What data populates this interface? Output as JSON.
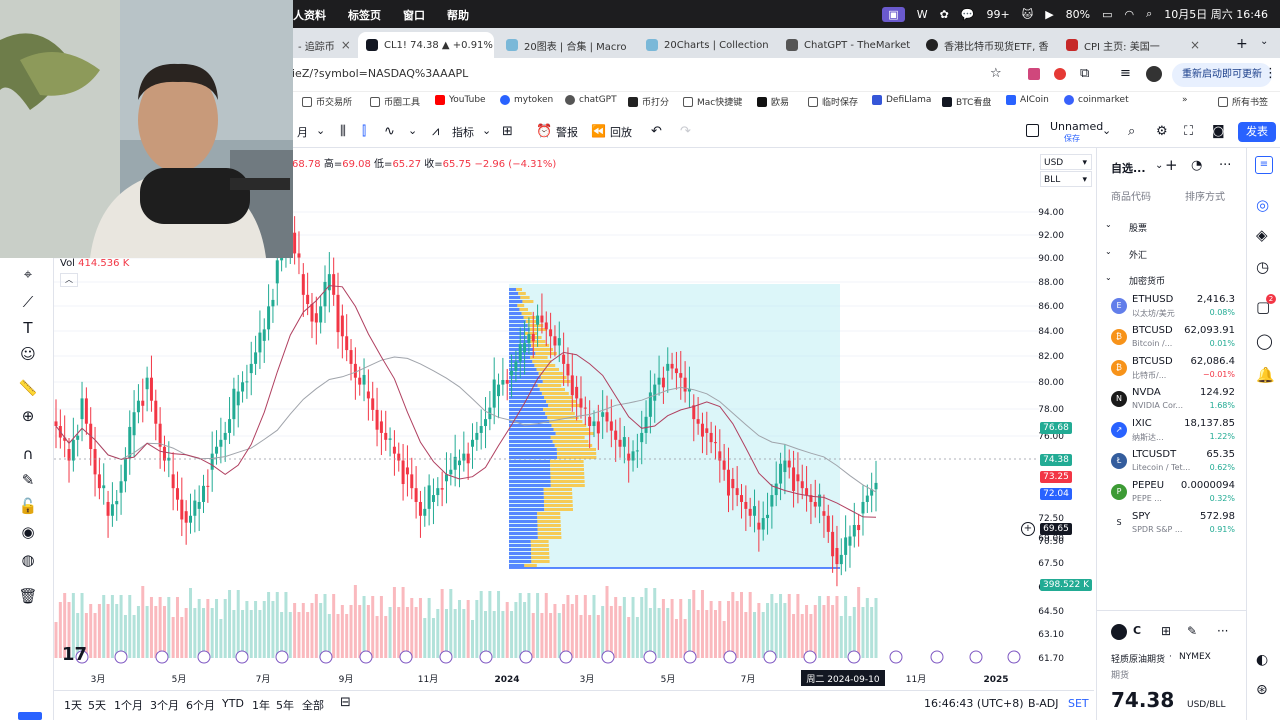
{
  "menubar": {
    "items": [
      "人资料",
      "标签页",
      "窗口",
      "帮助"
    ],
    "battery": "80%",
    "badge": "99+",
    "datetime": "10月5日 周六 16:46"
  },
  "tabs": [
    {
      "label": "- 追踪币",
      "active": false
    },
    {
      "label": "CL1! 74.38 ▲ +0.91%",
      "active": true
    },
    {
      "label": "20图表 | 合集 | Macro",
      "active": false
    },
    {
      "label": "20Charts | Collection",
      "active": false
    },
    {
      "label": "ChatGPT - TheMarket",
      "active": false
    },
    {
      "label": "香港比特币现货ETF, 香",
      "active": false
    },
    {
      "label": "CPI 主页: 美国一",
      "active": false
    }
  ],
  "address": {
    "url": "ieZ/?symbol=NASDAQ%3AAAPL",
    "restart_label": "重新启动即可更新"
  },
  "bookmarks": [
    "币交易所",
    "币圈工具",
    "YouTube",
    "mytoken",
    "chatGPT",
    "币打分",
    "Mac快捷键",
    "欧易",
    "临时保存",
    "DefiLlama",
    "BTC看盘",
    "AICoin",
    "coinmarket",
    "所有书签"
  ],
  "tv_toolbar": {
    "interval": "月",
    "indicators": "指标",
    "alert": "警报",
    "replay": "回放",
    "layout_name": "Unnamed",
    "layout_status": "保存",
    "publish": "发表"
  },
  "ohlc": {
    "prefix": "68.78",
    "high_label": "高=",
    "high": "69.08",
    "low_label": "低=",
    "low": "65.27",
    "close_label": "收=",
    "close": "65.75",
    "change": "−2.96 (−4.31%)"
  },
  "volume": {
    "label": "Vol",
    "value": "414.536 K"
  },
  "currency_select": "USD",
  "unit_select": "BLL",
  "price_labels": [
    {
      "value": "76.68",
      "color": "#22ab94"
    },
    {
      "value": "74.38",
      "color": "#22ab94"
    },
    {
      "value": "73.25",
      "color": "#f23645"
    },
    {
      "value": "72.04",
      "color": "#2962ff"
    },
    {
      "value": "69.65",
      "color": "#131722"
    },
    {
      "value": "398.522 K",
      "color": "#22ab94"
    }
  ],
  "chart_data": {
    "type": "candlestick",
    "y_ticks": [
      "94.00",
      "92.00",
      "90.00",
      "88.00",
      "86.00",
      "84.00",
      "82.00",
      "80.00",
      "78.00",
      "76.00",
      "72.50",
      "70.50",
      "69.00",
      "67.50",
      "66.00",
      "64.50",
      "63.10",
      "61.70"
    ],
    "x_ticks": [
      "3月",
      "5月",
      "7月",
      "9月",
      "11月",
      "2024",
      "3月",
      "5月",
      "7月",
      "周二 2024-09-10",
      "11月",
      "2025"
    ],
    "crosshair_date": "周二 2024-09-10",
    "crosshair_price": "69.65",
    "closes": [
      78.5,
      76.0,
      80.5,
      75.0,
      72.0,
      74.5,
      79.5,
      82.0,
      77.0,
      74.0,
      71.5,
      73.0,
      76.5,
      78.0,
      81.0,
      83.0,
      85.5,
      90.5,
      92.5,
      88.0,
      86.0,
      89.5,
      85.0,
      82.0,
      80.5,
      78.0,
      76.5,
      75.0,
      72.0,
      73.5,
      75.0,
      76.0,
      77.5,
      79.0,
      81.5,
      82.5,
      84.5,
      86.5,
      85.0,
      83.0,
      80.5,
      78.5,
      79.5,
      77.5,
      76.0,
      78.0,
      81.5,
      83.0,
      82.0,
      79.0,
      78.0,
      76.0,
      74.0,
      72.5,
      71.0,
      73.5,
      76.0,
      74.5,
      73.0,
      72.0,
      68.5,
      70.5,
      73.0,
      74.38
    ]
  },
  "bottom_bar": {
    "ranges": [
      "1天",
      "5天",
      "1个月",
      "3个月",
      "6个月",
      "YTD",
      "1年",
      "5年",
      "全部"
    ],
    "time": "16:46:43 (UTC+8)",
    "adj": "B-ADJ",
    "set": "SET"
  },
  "watchlist": {
    "title": "自选...",
    "col_symbol": "商品代码",
    "col_sort": "排序方式",
    "sections": [
      "股票",
      "外汇",
      "加密货币"
    ],
    "items": [
      {
        "symbol": "ETHUSD",
        "desc": "以太坊/美元",
        "last": "2,416.3",
        "chg": "0.08%",
        "up": true,
        "icon_color": "#627eea",
        "icon": "E"
      },
      {
        "symbol": "BTCUSD",
        "desc": "Bitcoin /...",
        "last": "62,093.91",
        "chg": "0.01%",
        "up": true,
        "icon_color": "#f7931a",
        "icon": "₿"
      },
      {
        "symbol": "BTCUSD",
        "desc": "比特币/...",
        "last": "62,086.4",
        "chg": "−0.01%",
        "up": false,
        "icon_color": "#f7931a",
        "icon": "₿"
      },
      {
        "symbol": "NVDA",
        "desc": "NVIDIA Cor...",
        "last": "124.92",
        "chg": "1.68%",
        "up": true,
        "icon_color": "#1a1a1a",
        "icon": "N"
      },
      {
        "symbol": "IXIC",
        "desc": "纳斯达...",
        "last": "18,137.85",
        "chg": "1.22%",
        "up": true,
        "icon_color": "#2962ff",
        "icon": "↗"
      },
      {
        "symbol": "LTCUSDT",
        "desc": "Litecoin / Tet...",
        "last": "65.35",
        "chg": "0.62%",
        "up": true,
        "icon_color": "#345d9d",
        "icon": "Ł"
      },
      {
        "symbol": "PEPEU",
        "desc": "PEPE ...",
        "last": "0.0000094",
        "chg": "0.32%",
        "up": true,
        "icon_color": "#3d9b35",
        "icon": "P"
      },
      {
        "symbol": "SPY",
        "desc": "SPDR S&P ...",
        "last": "572.98",
        "chg": "0.91%",
        "up": true,
        "icon_color": "#ffffff",
        "icon": "S"
      }
    ],
    "detail": {
      "symbol": "C",
      "name": "轻质原油期货",
      "exchange": "NYMEX",
      "type": "期货",
      "price": "74.38",
      "unit": "USD/BLL"
    }
  },
  "colors": {
    "up": "#22ab94",
    "down": "#f23645",
    "accent": "#2962ff"
  }
}
